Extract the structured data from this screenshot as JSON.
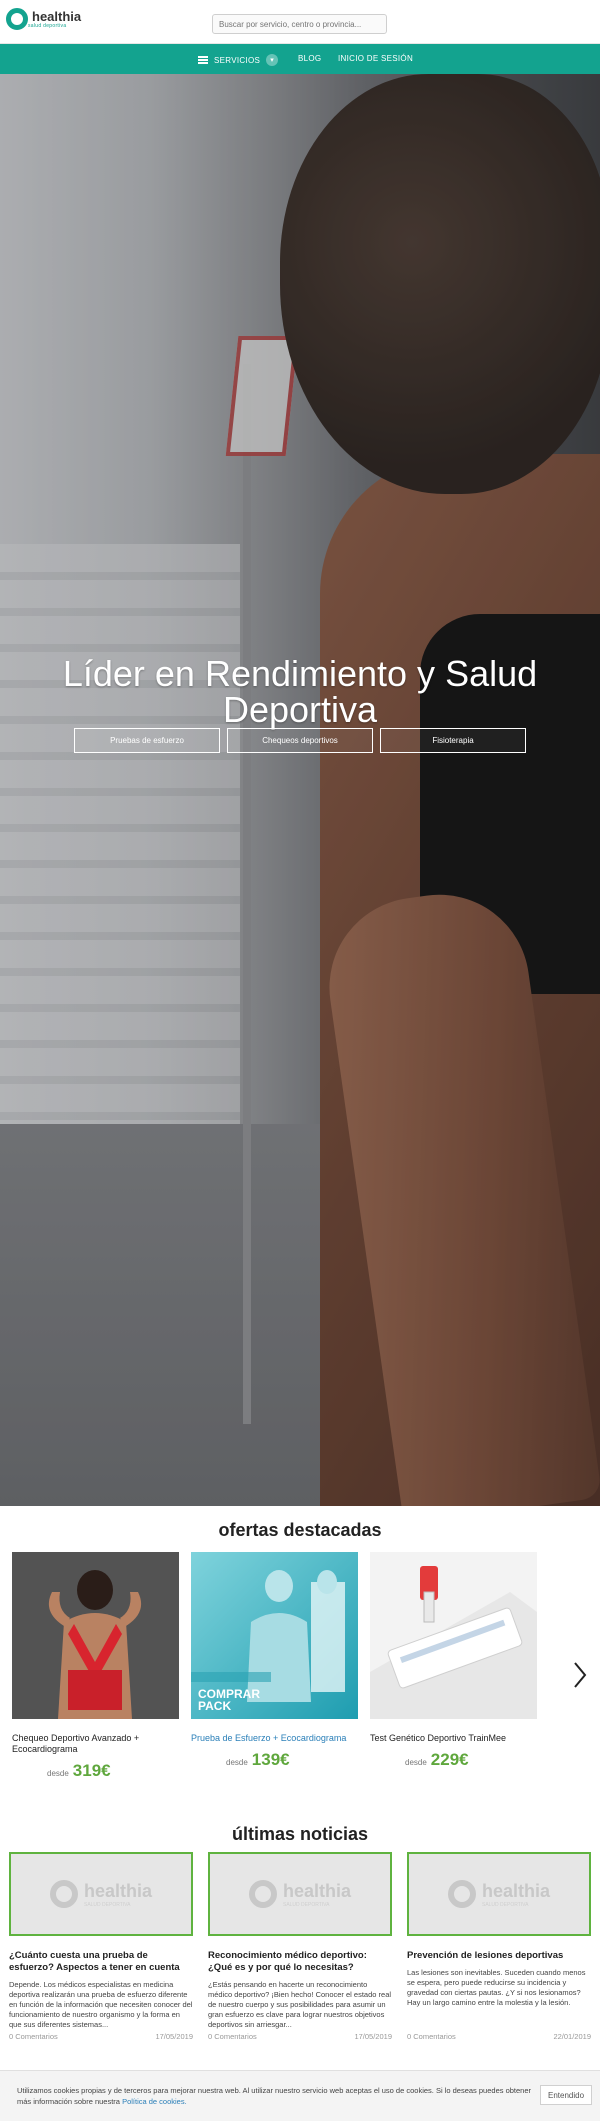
{
  "brand": {
    "name": "healthia",
    "tagline": "salud deportiva",
    "color": "#13a38f"
  },
  "search": {
    "placeholder": "Buscar por servicio, centro o provincia..."
  },
  "nav": {
    "servicios": "SERVICIOS",
    "blog": "BLOG",
    "login": "INICIO DE SESIÓN"
  },
  "hero": {
    "title": "Líder en Rendimiento y Salud Deportiva",
    "buttons": [
      "Pruebas de esfuerzo",
      "Chequeos deportivos",
      "Fisioterapia"
    ]
  },
  "offers": {
    "title": "ofertas destacadas",
    "items": [
      {
        "name": "Chequeo Deportivo Avanzado + Ecocardiograma",
        "desde": "desde",
        "price": "319€"
      },
      {
        "name": "Prueba de Esfuerzo + Ecocardiograma",
        "desde": "desde",
        "price": "139€",
        "badge": "COMPRAR PACK"
      },
      {
        "name": "Test Genético Deportivo TrainMee",
        "desde": "desde",
        "price": "229€"
      }
    ]
  },
  "news": {
    "title": "últimas noticias",
    "logo": {
      "name": "healthia",
      "tagline": "SALUD DEPORTIVA"
    },
    "items": [
      {
        "title": "¿Cuánto cuesta una prueba de esfuerzo? Aspectos a tener en cuenta",
        "excerpt": "Depende. Los médicos especialistas en medicina deportiva realizarán una prueba de esfuerzo diferente en función de la información que necesiten conocer del funcionamiento de nuestro organismo y la forma en que sus diferentes sistemas...",
        "comments": "0 Comentarios",
        "date": "17/05/2019"
      },
      {
        "title": "Reconocimiento médico deportivo: ¿Qué es y por qué lo necesitas?",
        "excerpt": "¿Estás pensando en hacerte un reconocimiento médico deportivo? ¡Bien hecho! Conocer el estado real de nuestro cuerpo y sus posibilidades para asumir un gran esfuerzo es clave para lograr nuestros objetivos deportivos sin arriesgar...",
        "comments": "0 Comentarios",
        "date": "17/05/2019"
      },
      {
        "title": "Prevención de lesiones deportivas",
        "excerpt": "Las lesiones son inevitables. Suceden cuando menos se espera, pero puede reducirse su incidencia y gravedad con ciertas pautas. ¿Y si nos lesionamos? Hay un largo camino entre la molestia y la lesión.",
        "comments": "0 Comentarios",
        "date": "22/01/2019"
      }
    ]
  },
  "cookie": {
    "text": "Utilizamos cookies propias y de terceros para mejorar nuestra web. Al utilizar nuestro servicio web aceptas el uso de cookies. Si lo deseas puedes obtener más información sobre nuestra ",
    "link": "Política de cookies.",
    "button": "Entendido"
  }
}
